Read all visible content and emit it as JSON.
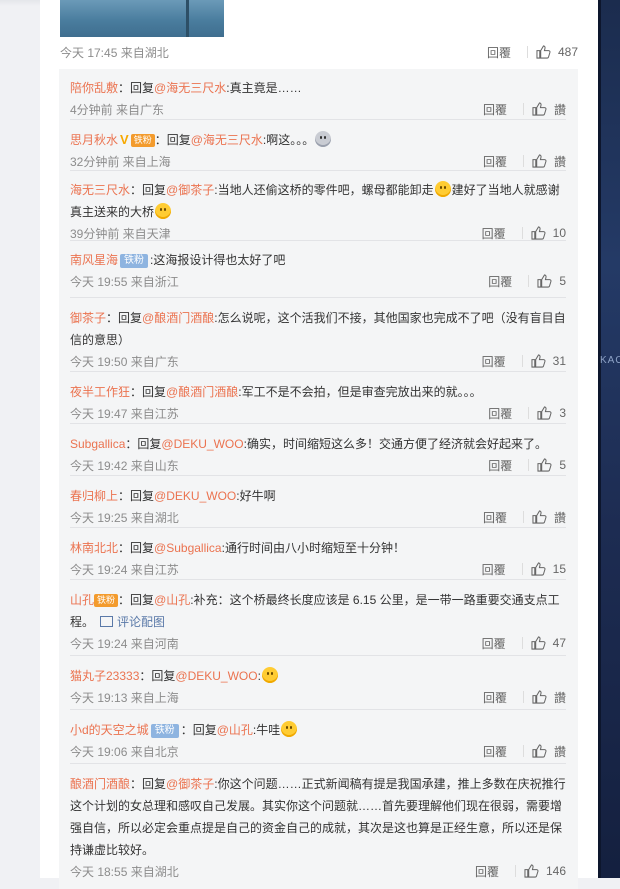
{
  "main_comment": {
    "time": "今天 17:45 来自湖北",
    "reply_label": "回覆",
    "likes": "487"
  },
  "replies": [
    {
      "user": "陪你乱敷",
      "reply_word": "回复",
      "mention": "@海无三尺水",
      "text": ":真主竟是……",
      "time": "4分钟前 来自广东",
      "reply_label": "回覆",
      "likes": "讚"
    },
    {
      "user": "思月秋水",
      "badges": [
        "V",
        "铁粉"
      ],
      "reply_word": "回复",
      "mention": "@海无三尺水",
      "text": ":啊这。。。",
      "emoji": "gray",
      "time": "32分钟前 来自上海",
      "reply_label": "回覆",
      "likes": "讚"
    },
    {
      "user": "海无三尺水",
      "reply_word": "回复",
      "mention": "@御茶子",
      "text": ":当地人还偷这桥的零件吧，螺母都能卸走",
      "emoji": "yellow",
      "text2": "建好了当地人就感谢真主送来的大桥",
      "emoji2": "yellow",
      "time": "39分钟前 来自天津",
      "reply_label": "回覆",
      "likes": "10"
    },
    {
      "user": "南风星海",
      "badges": [
        "铁粉"
      ],
      "reply_word": "",
      "mention": "",
      "text": ":这海报设计得也太好了吧",
      "time": "今天 19:55 来自浙江",
      "reply_label": "回覆",
      "likes": "5"
    },
    {
      "user": "御茶子",
      "reply_word": "回复",
      "mention": "@酿酒门酒酿",
      "text": ":怎么说呢，这个活我们不接，其他国家也完成不了吧（没有盲目自信的意思）",
      "time": "今天 19:50 来自广东",
      "reply_label": "回覆",
      "likes": "31"
    },
    {
      "user": "夜半工作狂",
      "reply_word": "回复",
      "mention": "@酿酒门酒酿",
      "text": ":军工不是不会拍，但是审查完放出来的就。。。",
      "time": "今天 19:47 来自江苏",
      "reply_label": "回覆",
      "likes": "3"
    },
    {
      "user": "Subgallica",
      "reply_word": "回复",
      "mention": "@DEKU_WOO",
      "text": ":确实，时间缩短这么多！交通方便了经济就会好起来了。",
      "time": "今天 19:42 来自山东",
      "reply_label": "回覆",
      "likes": "5"
    },
    {
      "user": "春归柳上",
      "reply_word": "回复",
      "mention": "@DEKU_WOO",
      "text": ":好牛啊",
      "time": "今天 19:25 来自湖北",
      "reply_label": "回覆",
      "likes": "讚"
    },
    {
      "user": "林南北北",
      "reply_word": "回复",
      "mention": "@Subgallica",
      "text": ":通行时间由八小时缩短至十分钟！",
      "time": "今天 19:24 来自江苏",
      "reply_label": "回覆",
      "likes": "15"
    },
    {
      "user": "山孔",
      "badges": [
        "铁粉"
      ],
      "reply_word": "回复",
      "mention": "@山孔",
      "text": ":补充：这个桥最终长度应该是 6.15 公里，是一带一路重要交通支点工程。",
      "pic": "评论配图",
      "time": "今天 19:24 来自河南",
      "reply_label": "回覆",
      "likes": "47"
    },
    {
      "user": "猫丸子23333",
      "reply_word": "回复",
      "mention": "@DEKU_WOO",
      "text": ":",
      "emoji": "yellow",
      "time": "今天 19:13 来自上海",
      "reply_label": "回覆",
      "likes": "讚"
    },
    {
      "user": "小d的天空之城",
      "badges": [
        "铁粉"
      ],
      "reply_word": "回复",
      "mention": "@山孔",
      "text": ":牛哇",
      "emoji": "yellow",
      "time": "今天 19:06 来自北京",
      "reply_label": "回覆",
      "likes": "讚"
    },
    {
      "user": "酿酒门酒酿",
      "reply_word": "回复",
      "mention": "@御茶子",
      "text": ":你这个问题……正式新闻稿有提是我国承建，推上多数在庆祝推行这个计划的女总理和感叹自己发展。其实你这个问题就……首先要理解他们现在很弱，需要增强自信，所以必定会重点提是自己的资金自己的成就，其次是这也算是正经生意，所以还是保持谦虚比较好。",
      "time": "今天 18:55 来自湖北",
      "reply_label": "回覆",
      "likes": "146"
    }
  ],
  "right_strip_text": "KAO",
  "colors": {
    "link": "#eb7350",
    "meta": "#8c8c8c",
    "reply_bg": "#f4f5f6"
  }
}
